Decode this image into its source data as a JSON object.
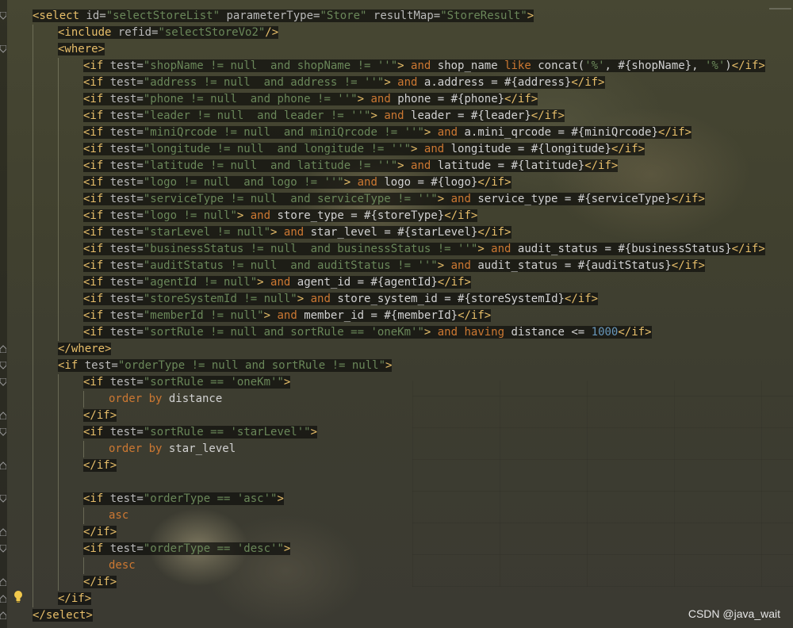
{
  "watermark": "CSDN @java_wait",
  "lines": [
    {
      "indent": 1,
      "tokens": [
        [
          "t",
          "<select "
        ],
        [
          "a",
          "id="
        ],
        [
          "s",
          "\"selectStoreList\" "
        ],
        [
          "a",
          "parameterType="
        ],
        [
          "s",
          "\"Store\" "
        ],
        [
          "a",
          "resultMap="
        ],
        [
          "s",
          "\"StoreResult\""
        ],
        [
          "t",
          ">"
        ]
      ]
    },
    {
      "indent": 2,
      "tokens": [
        [
          "t",
          "<include "
        ],
        [
          "a",
          "refid="
        ],
        [
          "s",
          "\"selectStoreVo2\""
        ],
        [
          "t",
          "/>"
        ]
      ]
    },
    {
      "indent": 2,
      "tokens": [
        [
          "t",
          "<where>"
        ]
      ]
    },
    {
      "indent": 3,
      "tokens": [
        [
          "t",
          "<if "
        ],
        [
          "a",
          "test="
        ],
        [
          "s",
          "\"shopName != null  and shopName != ''\""
        ],
        [
          "t",
          ">"
        ],
        [
          "k",
          " and "
        ],
        [
          "p",
          "shop_name "
        ],
        [
          "k",
          "like "
        ],
        [
          "p",
          "concat("
        ],
        [
          "s",
          "'%'"
        ],
        [
          "p",
          ", #{shopName}, "
        ],
        [
          "s",
          "'%'"
        ],
        [
          "p",
          ")"
        ],
        [
          "t",
          "</if>"
        ]
      ]
    },
    {
      "indent": 3,
      "tokens": [
        [
          "t",
          "<if "
        ],
        [
          "a",
          "test="
        ],
        [
          "s",
          "\"address != null  and address != ''\""
        ],
        [
          "t",
          ">"
        ],
        [
          "k",
          " and "
        ],
        [
          "p",
          "a.address = #{address}"
        ],
        [
          "t",
          "</if>"
        ]
      ]
    },
    {
      "indent": 3,
      "tokens": [
        [
          "t",
          "<if "
        ],
        [
          "a",
          "test="
        ],
        [
          "s",
          "\"phone != null  and phone != ''\""
        ],
        [
          "t",
          ">"
        ],
        [
          "k",
          " and "
        ],
        [
          "p",
          "phone = #{phone}"
        ],
        [
          "t",
          "</if>"
        ]
      ]
    },
    {
      "indent": 3,
      "tokens": [
        [
          "t",
          "<if "
        ],
        [
          "a",
          "test="
        ],
        [
          "s",
          "\"leader != null  and leader != ''\""
        ],
        [
          "t",
          ">"
        ],
        [
          "k",
          " and "
        ],
        [
          "p",
          "leader = #{leader}"
        ],
        [
          "t",
          "</if>"
        ]
      ]
    },
    {
      "indent": 3,
      "tokens": [
        [
          "t",
          "<if "
        ],
        [
          "a",
          "test="
        ],
        [
          "s",
          "\"miniQrcode != null  and miniQrcode != ''\""
        ],
        [
          "t",
          ">"
        ],
        [
          "k",
          " and "
        ],
        [
          "p",
          "a.mini_qrcode = #{miniQrcode}"
        ],
        [
          "t",
          "</if>"
        ]
      ]
    },
    {
      "indent": 3,
      "tokens": [
        [
          "t",
          "<if "
        ],
        [
          "a",
          "test="
        ],
        [
          "s",
          "\"longitude != null  and longitude != ''\""
        ],
        [
          "t",
          ">"
        ],
        [
          "k",
          " and "
        ],
        [
          "p",
          "longitude = #{longitude}"
        ],
        [
          "t",
          "</if>"
        ]
      ]
    },
    {
      "indent": 3,
      "tokens": [
        [
          "t",
          "<if "
        ],
        [
          "a",
          "test="
        ],
        [
          "s",
          "\"latitude != null  and latitude != ''\""
        ],
        [
          "t",
          ">"
        ],
        [
          "k",
          " and "
        ],
        [
          "p",
          "latitude = #{latitude}"
        ],
        [
          "t",
          "</if>"
        ]
      ]
    },
    {
      "indent": 3,
      "tokens": [
        [
          "t",
          "<if "
        ],
        [
          "a",
          "test="
        ],
        [
          "s",
          "\"logo != null  and logo != ''\""
        ],
        [
          "t",
          ">"
        ],
        [
          "k",
          " and "
        ],
        [
          "p",
          "logo = #{logo}"
        ],
        [
          "t",
          "</if>"
        ]
      ]
    },
    {
      "indent": 3,
      "tokens": [
        [
          "t",
          "<if "
        ],
        [
          "a",
          "test="
        ],
        [
          "s",
          "\"serviceType != null  and serviceType != ''\""
        ],
        [
          "t",
          ">"
        ],
        [
          "k",
          " and "
        ],
        [
          "p",
          "service_type = #{serviceType}"
        ],
        [
          "t",
          "</if>"
        ]
      ]
    },
    {
      "indent": 3,
      "tokens": [
        [
          "t",
          "<if "
        ],
        [
          "a",
          "test="
        ],
        [
          "s",
          "\"logo != null\""
        ],
        [
          "t",
          ">"
        ],
        [
          "k",
          " and "
        ],
        [
          "p",
          "store_type = #{storeType}"
        ],
        [
          "t",
          "</if>"
        ]
      ]
    },
    {
      "indent": 3,
      "tokens": [
        [
          "t",
          "<if "
        ],
        [
          "a",
          "test="
        ],
        [
          "s",
          "\"starLevel != null\""
        ],
        [
          "t",
          ">"
        ],
        [
          "k",
          " and "
        ],
        [
          "p",
          "star_level = #{starLevel}"
        ],
        [
          "t",
          "</if>"
        ]
      ]
    },
    {
      "indent": 3,
      "tokens": [
        [
          "t",
          "<if "
        ],
        [
          "a",
          "test="
        ],
        [
          "s",
          "\"businessStatus != null  and businessStatus != ''\""
        ],
        [
          "t",
          ">"
        ],
        [
          "k",
          " and "
        ],
        [
          "p",
          "audit_status = #{businessStatus}"
        ],
        [
          "t",
          "</if>"
        ]
      ]
    },
    {
      "indent": 3,
      "tokens": [
        [
          "t",
          "<if "
        ],
        [
          "a",
          "test="
        ],
        [
          "s",
          "\"auditStatus != null  and auditStatus != ''\""
        ],
        [
          "t",
          ">"
        ],
        [
          "k",
          " and "
        ],
        [
          "p",
          "audit_status = #{auditStatus}"
        ],
        [
          "t",
          "</if>"
        ]
      ]
    },
    {
      "indent": 3,
      "tokens": [
        [
          "t",
          "<if "
        ],
        [
          "a",
          "test="
        ],
        [
          "s",
          "\"agentId != null\""
        ],
        [
          "t",
          ">"
        ],
        [
          "k",
          " and "
        ],
        [
          "p",
          "agent_id = #{agentId}"
        ],
        [
          "t",
          "</if>"
        ]
      ]
    },
    {
      "indent": 3,
      "tokens": [
        [
          "t",
          "<if "
        ],
        [
          "a",
          "test="
        ],
        [
          "s",
          "\"storeSystemId != null\""
        ],
        [
          "t",
          ">"
        ],
        [
          "k",
          " and "
        ],
        [
          "p",
          "store_system_id = #{storeSystemId}"
        ],
        [
          "t",
          "</if>"
        ]
      ]
    },
    {
      "indent": 3,
      "tokens": [
        [
          "t",
          "<if "
        ],
        [
          "a",
          "test="
        ],
        [
          "s",
          "\"memberId != null\""
        ],
        [
          "t",
          ">"
        ],
        [
          "k",
          " and "
        ],
        [
          "p",
          "member_id = #{memberId}"
        ],
        [
          "t",
          "</if>"
        ]
      ]
    },
    {
      "indent": 3,
      "tokens": [
        [
          "t",
          "<if "
        ],
        [
          "a",
          "test="
        ],
        [
          "s",
          "\"sortRule != null and sortRule == 'oneKm'\""
        ],
        [
          "t",
          ">"
        ],
        [
          "k",
          " and having "
        ],
        [
          "p",
          "distance &lt;= "
        ],
        [
          "n",
          "1000"
        ],
        [
          "t",
          "</if>"
        ]
      ]
    },
    {
      "indent": 2,
      "tokens": [
        [
          "t",
          "</where>"
        ]
      ]
    },
    {
      "indent": 2,
      "tokens": [
        [
          "t",
          "<if "
        ],
        [
          "a",
          "test="
        ],
        [
          "s",
          "\"orderType != null and sortRule != null\""
        ],
        [
          "t",
          ">"
        ]
      ]
    },
    {
      "indent": 3,
      "tokens": [
        [
          "t",
          "<if "
        ],
        [
          "a",
          "test="
        ],
        [
          "s",
          "\"sortRule == 'oneKm'\""
        ],
        [
          "t",
          ">"
        ]
      ]
    },
    {
      "indent": 4,
      "plain": true,
      "tokens": [
        [
          "k",
          "order by "
        ],
        [
          "p",
          "distance"
        ]
      ]
    },
    {
      "indent": 3,
      "tokens": [
        [
          "t",
          "</if>"
        ]
      ]
    },
    {
      "indent": 3,
      "tokens": [
        [
          "t",
          "<if "
        ],
        [
          "a",
          "test="
        ],
        [
          "s",
          "\"sortRule == 'starLevel'\""
        ],
        [
          "t",
          ">"
        ]
      ]
    },
    {
      "indent": 4,
      "plain": true,
      "tokens": [
        [
          "k",
          "order by "
        ],
        [
          "p",
          "star_level"
        ]
      ]
    },
    {
      "indent": 3,
      "tokens": [
        [
          "t",
          "</if>"
        ]
      ]
    },
    {
      "indent": 0,
      "plain": true,
      "tokens": []
    },
    {
      "indent": 3,
      "tokens": [
        [
          "t",
          "<if "
        ],
        [
          "a",
          "test="
        ],
        [
          "s",
          "\"orderType == 'asc'\""
        ],
        [
          "t",
          ">"
        ]
      ]
    },
    {
      "indent": 4,
      "plain": true,
      "tokens": [
        [
          "k",
          "asc"
        ]
      ]
    },
    {
      "indent": 3,
      "tokens": [
        [
          "t",
          "</if>"
        ]
      ]
    },
    {
      "indent": 3,
      "tokens": [
        [
          "t",
          "<if "
        ],
        [
          "a",
          "test="
        ],
        [
          "s",
          "\"orderType == 'desc'\""
        ],
        [
          "t",
          ">"
        ]
      ]
    },
    {
      "indent": 4,
      "plain": true,
      "tokens": [
        [
          "k",
          "desc"
        ]
      ]
    },
    {
      "indent": 3,
      "tokens": [
        [
          "t",
          "</if>"
        ]
      ]
    },
    {
      "indent": 2,
      "tokens": [
        [
          "t",
          "</if>"
        ]
      ]
    },
    {
      "indent": 1,
      "tokens": [
        [
          "t",
          "</select>"
        ]
      ]
    }
  ]
}
